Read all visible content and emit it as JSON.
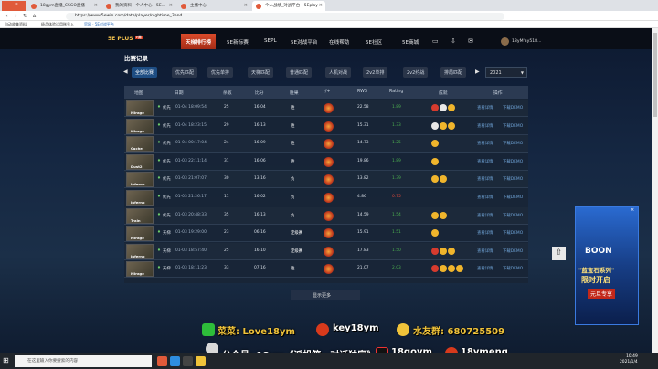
{
  "browser": {
    "tabs": [
      "18gym直播_CSGO直播",
      "我的资料 - 个人中心 - 5E...",
      "主播中心",
      "个人战绩_对战平台 - 5Eplay"
    ],
    "url": "https://www.5ewin.com/data/player/nightime_3end",
    "bookmarks": [
      "自动收集资料",
      "极品体验试用账号入",
      "官网 · 5E对战平台"
    ]
  },
  "site": {
    "brand": "5E PLUS",
    "badge": "7周",
    "nav": [
      "天梯排行榜",
      "5E新标赛",
      "SEPL",
      "5E对战平台",
      "在线帮助",
      "5E社区",
      "5E商城"
    ],
    "user": "18yM'ay518..."
  },
  "section": {
    "title": "比赛记录",
    "filters": [
      "全部比赛",
      "优先匹配",
      "优先单排",
      "天梯匹配",
      "普通匹配",
      "人机对战",
      "2v2单排",
      "2v2约战",
      "排局匹配"
    ],
    "year": "2021",
    "columns": [
      "地图",
      "日期",
      "杀敌",
      "比分",
      "胜果",
      "-/+",
      "RWS",
      "Rating",
      "成就",
      "操作"
    ]
  },
  "matches": [
    {
      "map": "Mirage",
      "mode": "优先",
      "date": "01-04 18:09:54",
      "kills": "25",
      "score": "16:04",
      "res": "胜",
      "rws": "22.58",
      "rating": "1.89",
      "rc": "#4caf50",
      "medals": [
        "red",
        "skull",
        "gold"
      ]
    },
    {
      "map": "Mirage",
      "mode": "优先",
      "date": "01-04 18:23:15",
      "kills": "29",
      "score": "16:13",
      "res": "胜",
      "rws": "15.31",
      "rating": "1.33",
      "rc": "#4caf50",
      "medals": [
        "skull",
        "gold",
        "gold"
      ]
    },
    {
      "map": "Cache",
      "mode": "优先",
      "date": "01-04 00:17:04",
      "kills": "24",
      "score": "16:09",
      "res": "胜",
      "rws": "14.73",
      "rating": "1.25",
      "rc": "#4caf50",
      "medals": [
        "gold"
      ]
    },
    {
      "map": "Dust2",
      "mode": "优先",
      "date": "01-03 22:11:14",
      "kills": "31",
      "score": "16:06",
      "res": "胜",
      "rws": "19.86",
      "rating": "1.89",
      "rc": "#4caf50",
      "medals": [
        "gold"
      ]
    },
    {
      "map": "Inferno",
      "mode": "优先",
      "date": "01-03 21:07:07",
      "kills": "30",
      "score": "13:16",
      "res": "负",
      "rws": "13.82",
      "rating": "1.39",
      "rc": "#4caf50",
      "medals": [
        "gold",
        "gold"
      ]
    },
    {
      "map": "Inferno",
      "mode": "优先",
      "date": "01-03 21:26:17",
      "kills": "11",
      "score": "16:02",
      "res": "负",
      "rws": "4.86",
      "rating": "0.75",
      "rc": "#e0483a",
      "medals": []
    },
    {
      "map": "Train",
      "mode": "优先",
      "date": "01-03 20:48:33",
      "kills": "35",
      "score": "16:13",
      "res": "负",
      "rws": "14.59",
      "rating": "1.54",
      "rc": "#4caf50",
      "medals": [
        "gold",
        "gold"
      ]
    },
    {
      "map": "Mirage",
      "mode": "天梯",
      "date": "01-03 19:29:00",
      "kills": "23",
      "score": "06:16",
      "res": "定级赛",
      "rws": "15.91",
      "rating": "1.51",
      "rc": "#4caf50",
      "medals": [
        "gold"
      ]
    },
    {
      "map": "Inferno",
      "mode": "天梯",
      "date": "01-03 18:57:40",
      "kills": "25",
      "score": "16:10",
      "res": "定级赛",
      "rws": "17.83",
      "rating": "1.50",
      "rc": "#4caf50",
      "medals": [
        "red",
        "gold",
        "gold"
      ]
    },
    {
      "map": "Mirage",
      "mode": "天梯",
      "date": "01-03 18:11:23",
      "kills": "33",
      "score": "07:16",
      "res": "胜",
      "rws": "21.07",
      "rating": "2.03",
      "rc": "#4caf50",
      "medals": [
        "red",
        "gold",
        "gold",
        "gold"
      ]
    }
  ],
  "actions": {
    "detail": "查看详情",
    "download": "下载DEMO"
  },
  "show_more": "显示更多",
  "ad": {
    "brand": "BOON",
    "line1": "\"蓝宝石系列\"",
    "line2": "限时开启",
    "line3": "元旦专享"
  },
  "overlay": {
    "wechat": "菜菜: Love18ym",
    "key": "key18ym",
    "qq": "水友群: 680725509",
    "gzh": "公众号: 18ym《派帆答一对话独家》",
    "douyin": "18goym",
    "weibo": "18ymeng"
  },
  "taskbar": {
    "search": "在这里输入你要搜索的内容",
    "time": "10:49",
    "date": "2021/1/4"
  }
}
